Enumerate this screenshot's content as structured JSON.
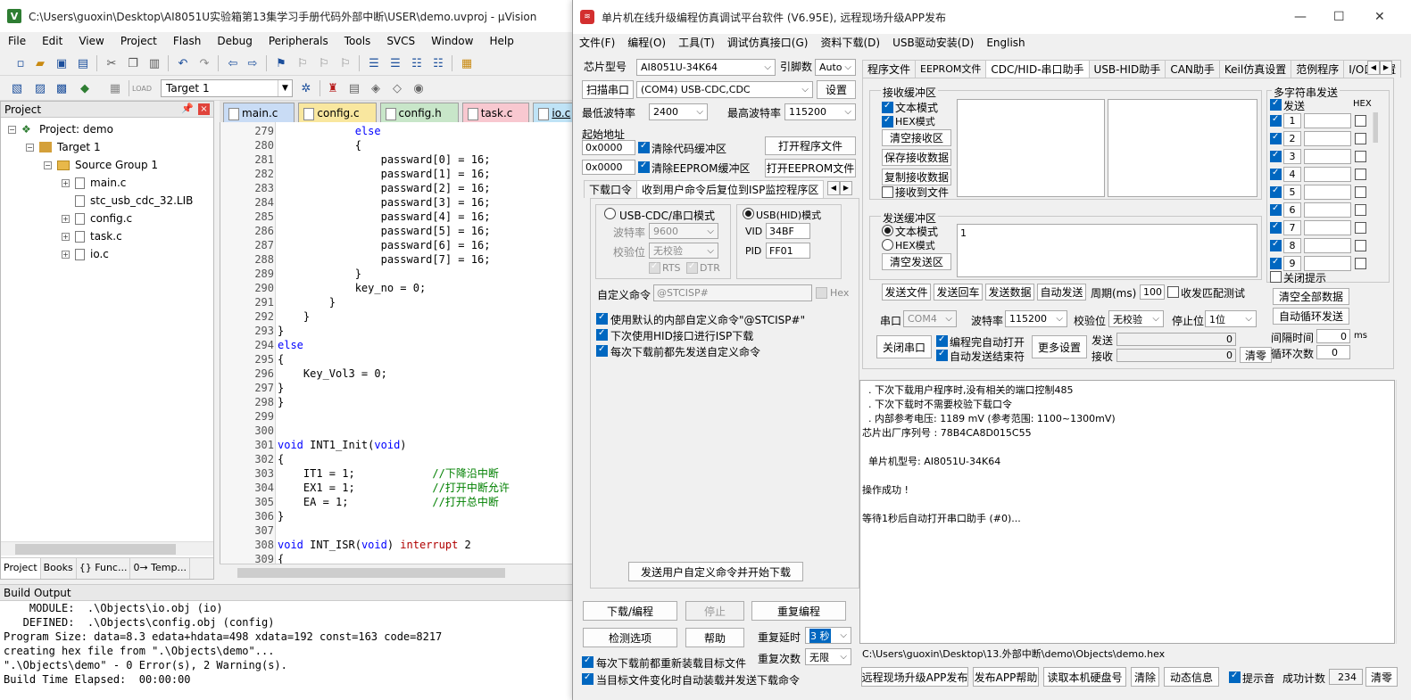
{
  "uvision": {
    "title": "C:\\Users\\guoxin\\Desktop\\AI8051U实验箱第13集学习手册代码外部中断\\USER\\demo.uvproj - µVision",
    "menu": [
      "File",
      "Edit",
      "View",
      "Project",
      "Flash",
      "Debug",
      "Peripherals",
      "Tools",
      "SVCS",
      "Window",
      "Help"
    ],
    "target": "Target 1",
    "project_pane": {
      "title": "Project",
      "tree": [
        {
          "label": "Project: demo",
          "level": 0
        },
        {
          "label": "Target 1",
          "level": 1
        },
        {
          "label": "Source Group 1",
          "level": 2
        },
        {
          "label": "main.c",
          "level": 3
        },
        {
          "label": "stc_usb_cdc_32.LIB",
          "level": 3
        },
        {
          "label": "config.c",
          "level": 3
        },
        {
          "label": "task.c",
          "level": 3
        },
        {
          "label": "io.c",
          "level": 3
        }
      ],
      "tabs": [
        "Project",
        "Books",
        "{} Func...",
        "0→ Temp..."
      ]
    },
    "editor_tabs": [
      {
        "label": "main.c",
        "color": "#c9dcf5"
      },
      {
        "label": "config.c",
        "color": "#f9e79f"
      },
      {
        "label": "config.h",
        "color": "#c8e6c9"
      },
      {
        "label": "task.c",
        "color": "#f8c8d0"
      },
      {
        "label": "io.c",
        "color": "#bfe3f6"
      }
    ],
    "code": [
      {
        "n": "279",
        "t": "            else"
      },
      {
        "n": "280",
        "t": "            {"
      },
      {
        "n": "281",
        "t": "                passward[0] = 16;"
      },
      {
        "n": "282",
        "t": "                passward[1] = 16;"
      },
      {
        "n": "283",
        "t": "                passward[2] = 16;"
      },
      {
        "n": "284",
        "t": "                passward[3] = 16;"
      },
      {
        "n": "285",
        "t": "                passward[4] = 16;"
      },
      {
        "n": "286",
        "t": "                passward[5] = 16;"
      },
      {
        "n": "287",
        "t": "                passward[6] = 16;"
      },
      {
        "n": "288",
        "t": "                passward[7] = 16;"
      },
      {
        "n": "289",
        "t": "            }"
      },
      {
        "n": "290",
        "t": "            key_no = 0;"
      },
      {
        "n": "291",
        "t": "        }"
      },
      {
        "n": "292",
        "t": "    }"
      },
      {
        "n": "293",
        "t": "}"
      },
      {
        "n": "294",
        "t": "else"
      },
      {
        "n": "295",
        "t": "{"
      },
      {
        "n": "296",
        "t": "    Key_Vol3 = 0;"
      },
      {
        "n": "297",
        "t": "}"
      },
      {
        "n": "298",
        "t": "}"
      },
      {
        "n": "299",
        "t": ""
      },
      {
        "n": "300",
        "t": ""
      },
      {
        "n": "301",
        "t": "void INT1_Init(void)"
      },
      {
        "n": "302",
        "t": "{"
      },
      {
        "n": "303",
        "t": "    IT1 = 1;            //下降沿中断"
      },
      {
        "n": "304",
        "t": "    EX1 = 1;            //打开中断允许"
      },
      {
        "n": "305",
        "t": "    EA = 1;             //打开总中断"
      },
      {
        "n": "306",
        "t": "}"
      },
      {
        "n": "307",
        "t": ""
      },
      {
        "n": "308",
        "t": "void INT_ISR(void) interrupt 2"
      },
      {
        "n": "309",
        "t": "{"
      }
    ],
    "build_title": "Build Output",
    "build_lines": [
      "    MODULE:  .\\Objects\\io.obj (io)",
      "   DEFINED:  .\\Objects\\config.obj (config)",
      "Program Size: data=8.3 edata+hdata=498 xdata=192 const=163 code=8217",
      "creating hex file from \".\\Objects\\demo\"...",
      "\".\\Objects\\demo\" - 0 Error(s), 2 Warning(s).",
      "Build Time Elapsed:  00:00:00"
    ]
  },
  "isp": {
    "title": "单片机在线升级编程仿真调试平台软件 (V6.95E), 远程现场升级APP发布",
    "menu": [
      "文件(F)",
      "编程(O)",
      "工具(T)",
      "调试仿真接口(G)",
      "资料下载(D)",
      "USB驱动安装(D)",
      "English"
    ],
    "chip_label": "芯片型号",
    "chip_value": "AI8051U-34K64",
    "pin_label": "引脚数",
    "pin_value": "Auto",
    "scan_button": "扫描串口",
    "port_value": "(COM4) USB-CDC,CDC",
    "settings_button": "设置",
    "min_baud_label": "最低波特率",
    "min_baud": "2400",
    "max_baud_label": "最高波特率",
    "max_baud": "115200",
    "start_addr_label": "起始地址",
    "addr1": "0x0000",
    "addr2": "0x0000",
    "clear_code": "清除代码缓冲区",
    "clear_eeprom": "清除EEPROM缓冲区",
    "open_prog": "打开程序文件",
    "open_eeprom": "打开EEPROM文件",
    "left_tabs": [
      "下载口令",
      "收到用户命令后复位到ISP监控程序区"
    ],
    "usb_cdc_mode": "USB-CDC/串口模式",
    "usb_hid_mode": "USB(HID)模式",
    "baud_label": "波特率",
    "baud_value": "9600",
    "parity_label": "校验位",
    "parity_value": "无校验",
    "rts": "RTS",
    "dtr": "DTR",
    "vid_label": "VID",
    "vid": "34BF",
    "pid_label": "PID",
    "pid": "FF01",
    "custom_cmd_label": "自定义命令",
    "custom_cmd": "@STCISP#",
    "hex_label": "Hex",
    "opt1": "使用默认的内部自定义命令\"@STCISP#\"",
    "opt2": "下次使用HID接口进行ISP下载",
    "opt3": "每次下载前都先发送自定义命令",
    "send_custom_btn": "发送用户自定义命令并开始下载",
    "download_btn": "下载/编程",
    "stop_btn": "停止",
    "reprogram_btn": "重复编程",
    "check_btn": "检测选项",
    "help_btn": "帮助",
    "repeat_delay_label": "重复延时",
    "repeat_delay": "3 秒",
    "repeat_count_label": "重复次数",
    "repeat_count": "无限",
    "reload_opt": "每次下载前都重新装载目标文件",
    "auto_send_opt": "当目标文件变化时自动装载并发送下载命令",
    "right_tabs": [
      "程序文件",
      "EEPROM文件",
      "CDC/HID-串口助手",
      "USB-HID助手",
      "CAN助手",
      "Keil仿真设置",
      "范例程序",
      "I/O口配置"
    ],
    "recv_title": "接收缓冲区",
    "text_mode": "文本模式",
    "hex_mode": "HEX模式",
    "clear_recv": "清空接收区",
    "save_recv": "保存接收数据",
    "copy_recv": "复制接收数据",
    "recv_to_file": "接收到文件",
    "send_title": "发送缓冲区",
    "send_text_mode": "文本模式",
    "send_hex_mode": "HEX模式",
    "clear_send": "清空发送区",
    "send_content": "1",
    "send_file": "发送文件",
    "send_return": "发送回车",
    "send_data": "发送数据",
    "auto_send": "自动发送",
    "period_label": "周期(ms)",
    "period": "100",
    "recv_match": "收发匹配测试",
    "port_label": "串口",
    "port_com": "COM4",
    "baud2_label": "波特率",
    "baud2": "115200",
    "parity2_label": "校验位",
    "parity2": "无校验",
    "stop_label": "停止位",
    "stop_value": "1位",
    "close_port": "关闭串口",
    "auto_open": "编程完自动打开",
    "auto_end": "自动发送结束符",
    "more_settings": "更多设置",
    "send_count_label": "发送",
    "send_count": "0",
    "recv_count_label": "接收",
    "recv_count": "0",
    "clear_count": "清零",
    "multi_title": "多字符串发送",
    "multi_send": "发送",
    "multi_hex": "HEX",
    "multi_rows": [
      "1",
      "2",
      "3",
      "4",
      "5",
      "6",
      "7",
      "8",
      "9"
    ],
    "close_tip": "关闭提示",
    "clear_all": "清空全部数据",
    "auto_loop": "自动循环发送",
    "interval_label": "间隔时间",
    "interval": "0",
    "interval_unit": "ms",
    "loop_label": "循环次数",
    "loop": "0",
    "log_lines": [
      "  . 下次下载用户程序时,没有相关的端口控制485",
      "  . 下次下载时不需要校验下载口令",
      "  . 内部参考电压: 1189 mV (参考范围: 1100~1300mV)",
      "芯片出厂序列号 : 78B4CA8D015C55",
      "",
      "  单片机型号: AI8051U-34K64",
      "",
      "操作成功 !",
      "",
      "等待1秒后自动打开串口助手 (#0)..."
    ],
    "hex_path": "C:\\Users\\guoxin\\Desktop\\13.外部中断\\demo\\Objects\\demo.hex",
    "bottom_btns": [
      "远程现场升级APP发布",
      "发布APP帮助",
      "读取本机硬盘号",
      "清除",
      "动态信息"
    ],
    "beep": "提示音",
    "success_label": "成功计数",
    "success": "234",
    "clear_success": "清零"
  }
}
